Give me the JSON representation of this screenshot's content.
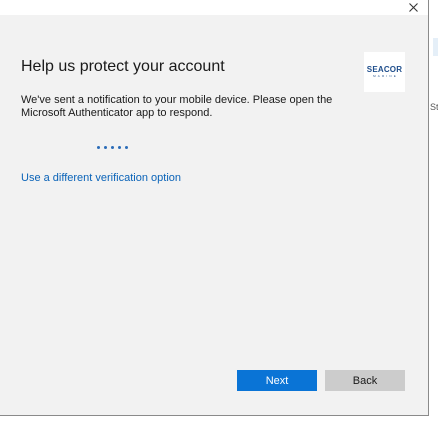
{
  "dialog": {
    "heading": "Help us protect your account",
    "message": "We've sent a notification to your mobile device. Please open the Microsoft Authenticator app to respond.",
    "link": "Use a different verification option",
    "logo": {
      "main": "SEACOR",
      "sub": "MARINE"
    },
    "buttons": {
      "next": "Next",
      "back": "Back"
    },
    "close_icon": "close-icon",
    "loading_icon": "loading-dots-icon",
    "accent_color": "#0a74d6"
  },
  "background": {
    "partial_text": "St"
  }
}
